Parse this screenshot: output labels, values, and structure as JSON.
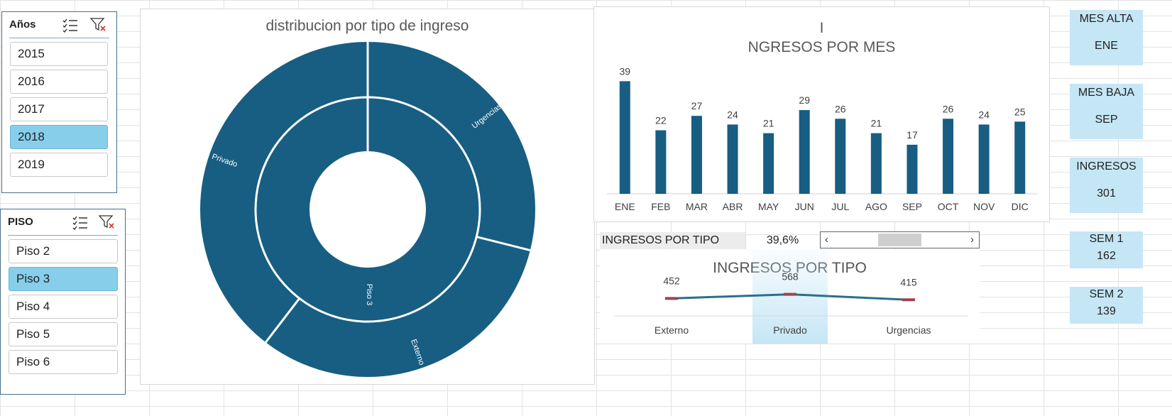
{
  "years_slicer": {
    "title": "Años",
    "items": [
      "2015",
      "2016",
      "2017",
      "2018",
      "2019"
    ],
    "selected": "2018"
  },
  "piso_slicer": {
    "title": "PISO",
    "items": [
      "Piso 2",
      "Piso 3",
      "Piso 4",
      "Piso 5",
      "Piso 6"
    ],
    "selected": "Piso 3"
  },
  "donut": {
    "title": "distribucion por tipo de ingreso",
    "inner_label": "Piso 3",
    "outer_labels": [
      "Urgencias",
      "Externo",
      "Privado"
    ]
  },
  "monthly": {
    "title_line1": "I",
    "title_line2": "NGRESOS POR MES"
  },
  "ingresos_tipo_row": {
    "label": "INGRESOS POR TIPO",
    "value": "39,6%"
  },
  "line_chart": {
    "title": "INGRESOS POR TIPO"
  },
  "kpis": [
    {
      "label": "MES ALTA",
      "value": "ENE"
    },
    {
      "label": "MES BAJA",
      "value": "SEP"
    },
    {
      "label": "INGRESOS",
      "value": "301"
    },
    {
      "label": "SEM 1",
      "value": "162"
    },
    {
      "label": "SEM 2",
      "value": "139"
    }
  ],
  "colors": {
    "series": "#175e82",
    "selection": "#87ceeb",
    "kpi_bg": "#c5e6f5"
  },
  "chart_data": [
    {
      "type": "pie",
      "title": "distribucion por tipo de ingreso",
      "categories": [
        "Urgencias",
        "Externo",
        "Privado"
      ],
      "values": [
        415,
        452,
        568
      ]
    },
    {
      "type": "bar",
      "title": "I NGRESOS POR MES",
      "categories": [
        "ENE",
        "FEB",
        "MAR",
        "ABR",
        "MAY",
        "JUN",
        "JUL",
        "AGO",
        "SEP",
        "OCT",
        "NOV",
        "DIC"
      ],
      "values": [
        39,
        22,
        27,
        24,
        21,
        29,
        26,
        21,
        17,
        26,
        24,
        25
      ],
      "ylim": [
        0,
        45
      ]
    },
    {
      "type": "line",
      "title": "INGRESOS POR TIPO",
      "categories": [
        "Externo",
        "Privado",
        "Urgencias"
      ],
      "values": [
        452,
        568,
        415
      ],
      "highlighted": "Privado"
    }
  ]
}
